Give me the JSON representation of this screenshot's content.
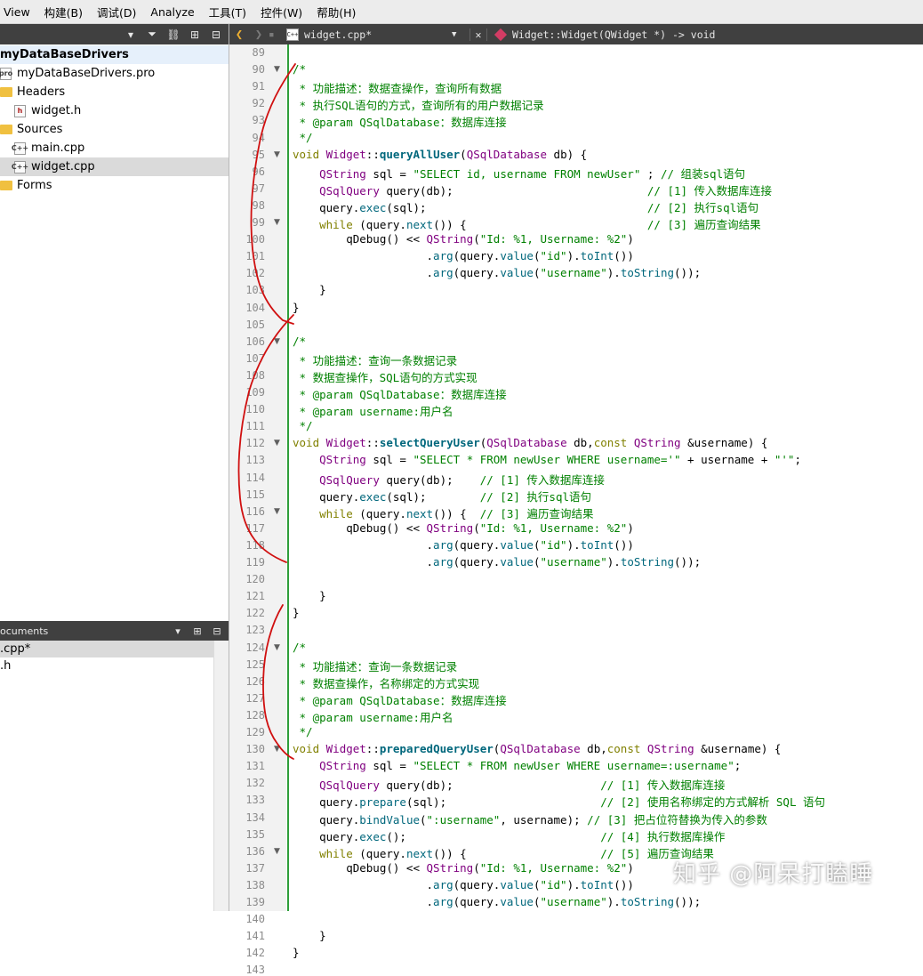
{
  "menu": [
    "View",
    "构建(B)",
    "调试(D)",
    "Analyze",
    "工具(T)",
    "控件(W)",
    "帮助(H)"
  ],
  "project_tree": {
    "root": "myDataBaseDrivers",
    "items": [
      {
        "label": "myDataBaseDrivers.pro",
        "icon": "pro-file-icon",
        "indent": 1
      },
      {
        "label": "Headers",
        "icon": "folder-headers-icon",
        "indent": 1
      },
      {
        "label": "widget.h",
        "icon": "header-file-icon",
        "indent": 2
      },
      {
        "label": "Sources",
        "icon": "folder-sources-icon",
        "indent": 1
      },
      {
        "label": "main.cpp",
        "icon": "cpp-file-icon",
        "indent": 2
      },
      {
        "label": "widget.cpp",
        "icon": "cpp-file-icon",
        "indent": 2
      },
      {
        "label": "Forms",
        "icon": "folder-forms-icon",
        "indent": 1
      }
    ]
  },
  "open_documents": {
    "title": "ocuments",
    "items": [
      ".cpp*",
      ".h"
    ]
  },
  "editor": {
    "file_name": "widget.cpp*",
    "symbol": "Widget::Widget(QWidget *) -> void",
    "first_line": 89,
    "lines": [
      "",
      "/*",
      " * 功能描述：数据查操作，查询所有数据",
      " * 执行SQL语句的方式，查询所有的用户数据记录",
      " * @param QSqlDatabase：数据库连接",
      " */",
      "void Widget::queryAllUser(QSqlDatabase db) {",
      "    QString sql = \"SELECT id, username FROM newUser\" ; // 组装sql语句",
      "    QSqlQuery query(db);                             // [1] 传入数据库连接",
      "    query.exec(sql);                                 // [2] 执行sql语句",
      "    while (query.next()) {                           // [3] 遍历查询结果",
      "        qDebug() << QString(\"Id: %1, Username: %2\")",
      "                    .arg(query.value(\"id\").toInt())",
      "                    .arg(query.value(\"username\").toString());",
      "    }",
      "}",
      "",
      "/*",
      " * 功能描述：查询一条数据记录",
      " * 数据查操作，SQL语句的方式实现",
      " * @param QSqlDatabase：数据库连接",
      " * @param username:用户名",
      " */",
      "void Widget::selectQueryUser(QSqlDatabase db,const QString &username) {",
      "    QString sql = \"SELECT * FROM newUser WHERE username='\" + username + \"'\";",
      "    QSqlQuery query(db);    // [1] 传入数据库连接",
      "    query.exec(sql);        // [2] 执行sql语句",
      "    while (query.next()) {  // [3] 遍历查询结果",
      "        qDebug() << QString(\"Id: %1, Username: %2\")",
      "                    .arg(query.value(\"id\").toInt())",
      "                    .arg(query.value(\"username\").toString());",
      "",
      "    }",
      "}",
      "",
      "/*",
      " * 功能描述：查询一条数据记录",
      " * 数据查操作，名称绑定的方式实现",
      " * @param QSqlDatabase：数据库连接",
      " * @param username:用户名",
      " */",
      "void Widget::preparedQueryUser(QSqlDatabase db,const QString &username) {",
      "    QString sql = \"SELECT * FROM newUser WHERE username=:username\";",
      "    QSqlQuery query(db);                      // [1] 传入数据库连接",
      "    query.prepare(sql);                       // [2] 使用名称绑定的方式解析 SQL 语句",
      "    query.bindValue(\":username\", username); // [3] 把占位符替换为传入的参数",
      "    query.exec();                             // [4] 执行数据库操作",
      "    while (query.next()) {                    // [5] 遍历查询结果",
      "        qDebug() << QString(\"Id: %1, Username: %2\")",
      "                    .arg(query.value(\"id\").toInt())",
      "                    .arg(query.value(\"username\").toString());",
      "",
      "    }",
      "}",
      ""
    ],
    "fold_lines": [
      90,
      95,
      99,
      106,
      112,
      116,
      124,
      130,
      136
    ]
  },
  "watermark": "知乎 @阿呆打瞌睡",
  "colors": {
    "comment": "#008000",
    "keyword": "#808000",
    "type": "#800080",
    "function": "#00677c",
    "annotation": "#d01010",
    "gutter_line": "#2e9e3a"
  }
}
